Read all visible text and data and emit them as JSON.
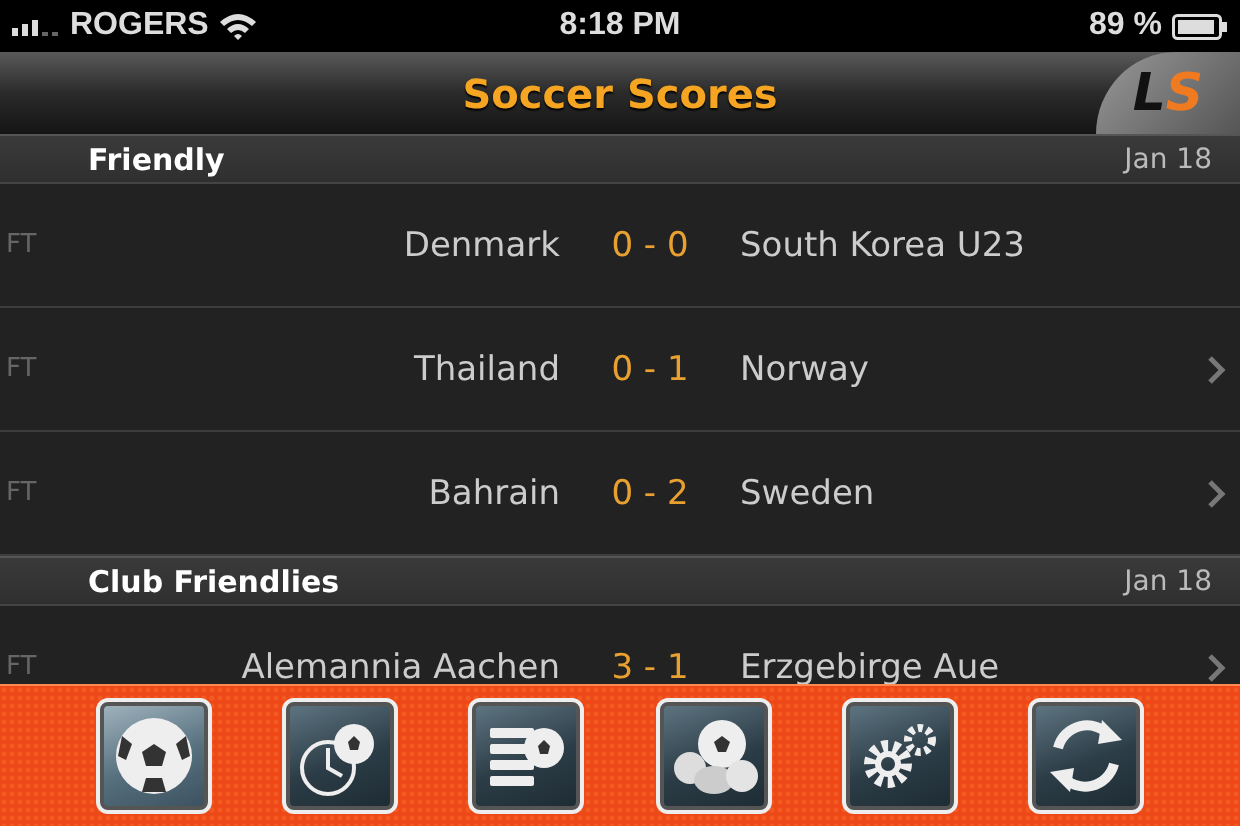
{
  "status_bar": {
    "carrier": "ROGERS",
    "time": "8:18 PM",
    "battery": "89 %"
  },
  "nav_bar": {
    "title": "Soccer Scores",
    "logo": [
      "L",
      "S"
    ]
  },
  "sections": [
    {
      "name": "Friendly",
      "date": "Jan 18",
      "matches": [
        {
          "status": "FT",
          "home": "Denmark",
          "score": "0 - 0",
          "away": "South Korea U23",
          "has_details": false
        },
        {
          "status": "FT",
          "home": "Thailand",
          "score": "0 - 1",
          "away": "Norway",
          "has_details": true
        },
        {
          "status": "FT",
          "home": "Bahrain",
          "score": "0 - 2",
          "away": "Sweden",
          "has_details": true
        }
      ]
    },
    {
      "name": "Club Friendlies",
      "date": "Jan 18",
      "matches": [
        {
          "status": "FT",
          "home": "Alemannia Aachen",
          "score": "3 - 1",
          "away": "Erzgebirge Aue",
          "has_details": true
        }
      ]
    }
  ],
  "tab_bar": [
    {
      "kind": "ball",
      "selected": true
    },
    {
      "kind": "clock",
      "selected": false
    },
    {
      "kind": "list",
      "selected": false
    },
    {
      "kind": "balls",
      "selected": false
    },
    {
      "kind": "gears",
      "selected": false
    },
    {
      "kind": "refresh",
      "selected": false
    }
  ]
}
